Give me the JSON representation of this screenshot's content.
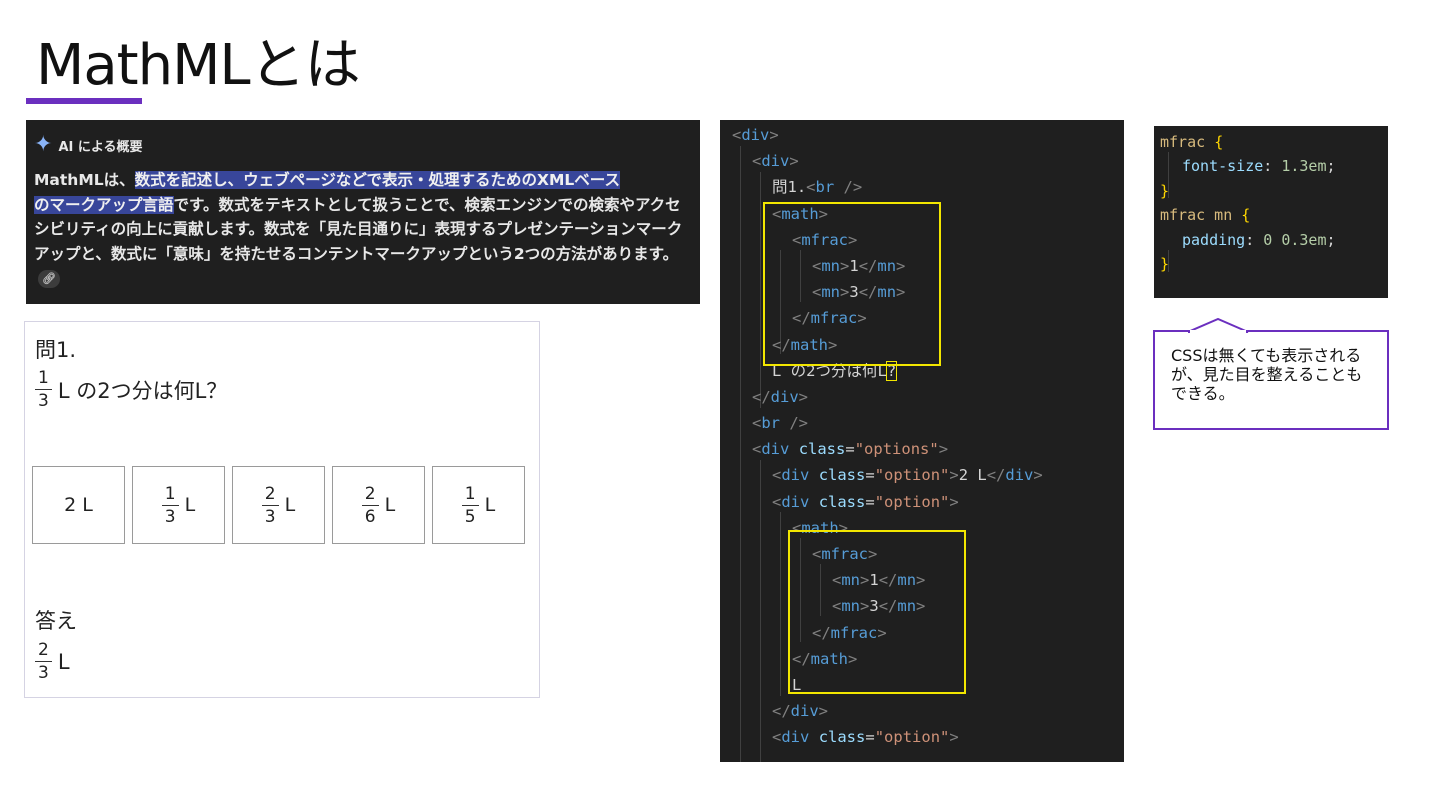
{
  "title": "MathMLとは",
  "ai_overview": {
    "header": "AI による概要",
    "text_before_highlight": "MathMLは、",
    "highlight_1": "数式を記述し、ウェブページなどで表示・処理するためのXMLベース",
    "highlight_2": "のマークアップ言語",
    "text_after": "です。数式をテキストとして扱うことで、検索エンジンでの検索やアクセシビリティの向上に貢献します。数式を「見た目通りに」表現するプレゼンテーションマークアップと、数式に「意味」を持たせるコンテントマークアップという2つの方法があります。",
    "link_icon": "link-icon"
  },
  "preview": {
    "question_label": "問1.",
    "question_frac": {
      "num": "1",
      "den": "3"
    },
    "question_text": "L の2つ分は何L？",
    "options": [
      {
        "plain": "2 L"
      },
      {
        "num": "1",
        "den": "3",
        "unit": "L"
      },
      {
        "num": "2",
        "den": "3",
        "unit": "L"
      },
      {
        "num": "2",
        "den": "6",
        "unit": "L"
      },
      {
        "num": "1",
        "den": "5",
        "unit": "L"
      }
    ],
    "answer_label": "答え",
    "answer_frac": {
      "num": "2",
      "den": "3"
    },
    "answer_unit": "L"
  },
  "html_code": [
    "<div>",
    "<div>",
    "問1.<br />",
    "<math>",
    "<mfrac>",
    "<mn>1</mn>",
    "<mn>3</mn>",
    "</mfrac>",
    "</math>",
    "L の2つ分は何L?",
    "</div>",
    "<br />",
    "<div class=\"options\">",
    "<div class=\"option\">2 L</div>",
    "<div class=\"option\">",
    "<math>",
    "<mfrac>",
    "<mn>1</mn>",
    "<mn>3</mn>",
    "</mfrac>",
    "</math>",
    "L",
    "</div>",
    "<div class=\"option\">"
  ],
  "css_code": {
    "sel1": "mfrac",
    "prop1": "font-size",
    "val1": "1.3em",
    "sel2": "mfrac mn",
    "prop2": "padding",
    "val2": "0 0.3em"
  },
  "callout": "CSSは無くても表示されるが、見た目を整えることもできる。",
  "colors": {
    "accent": "#6b2fbf",
    "highlight_box": "#f2e600",
    "code_bg": "#1f1f1f"
  }
}
